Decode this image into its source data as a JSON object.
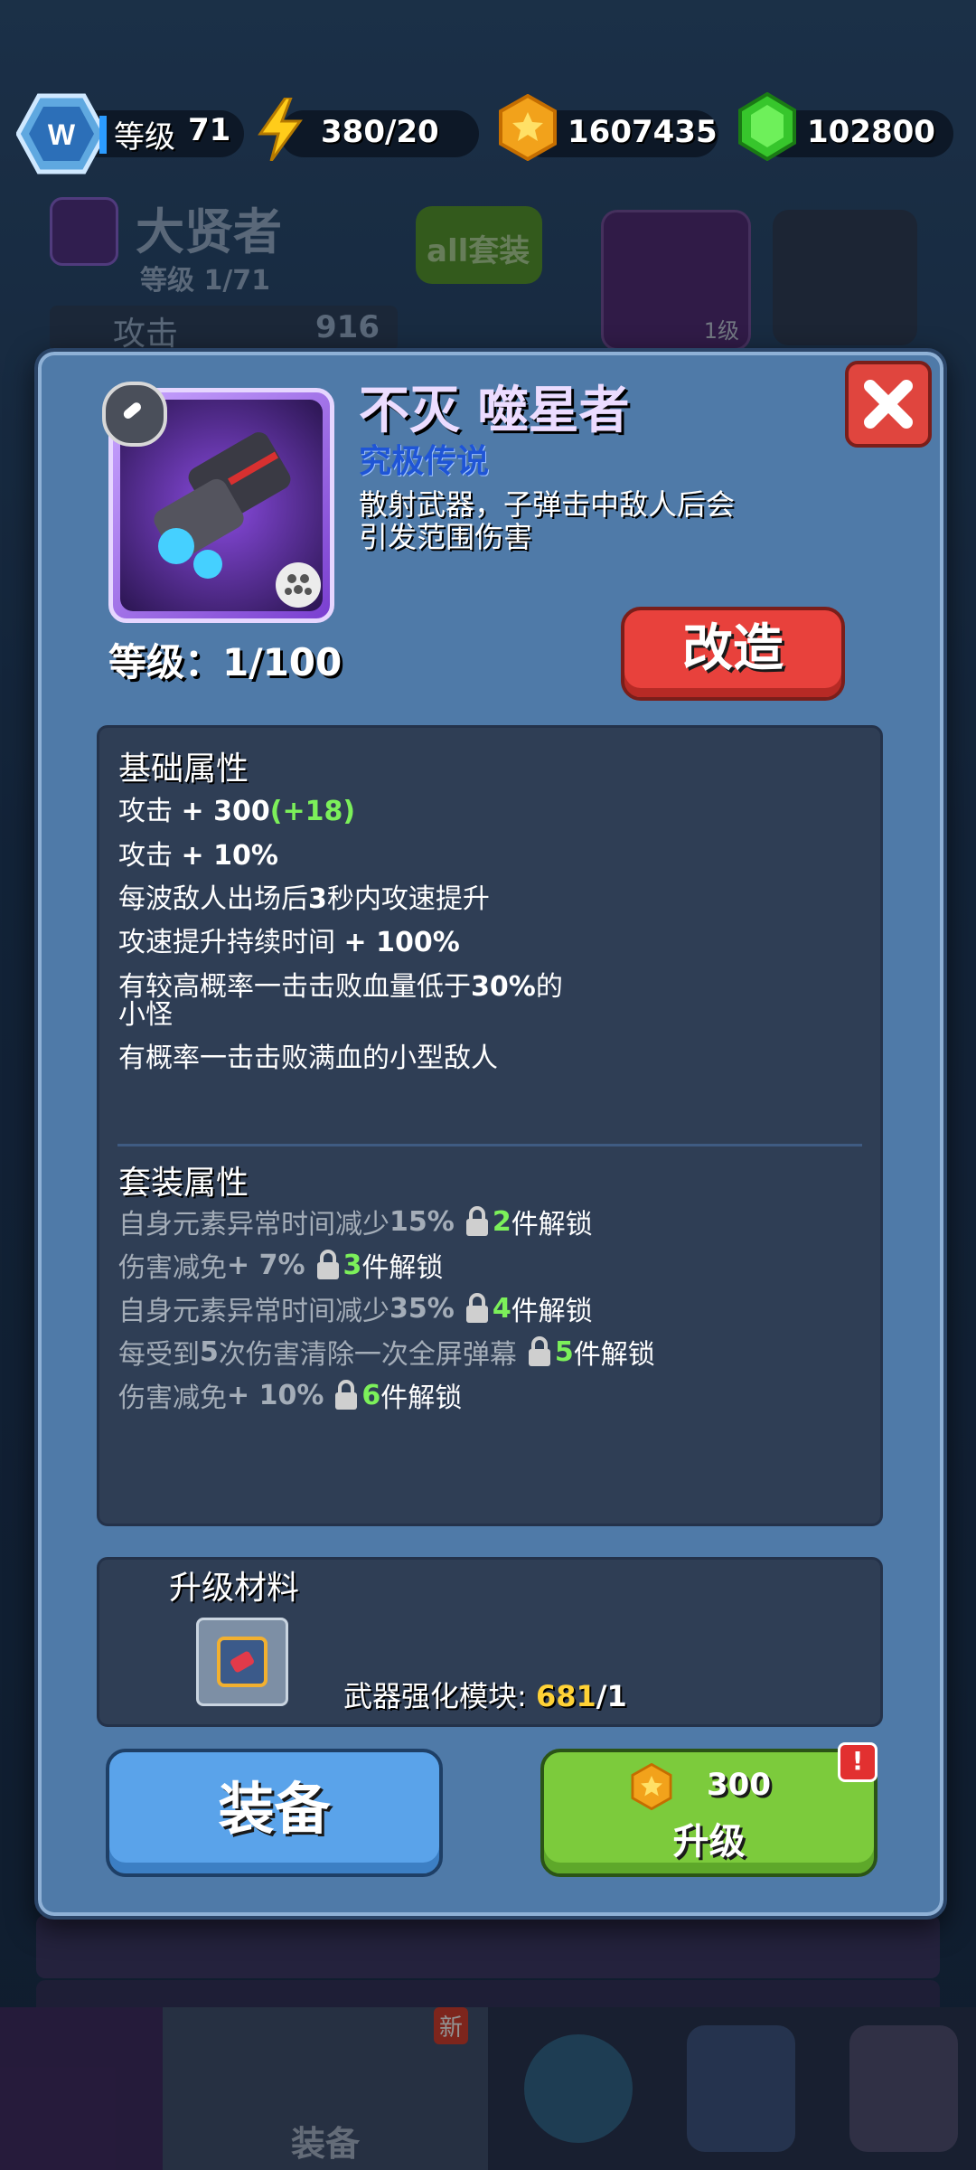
{
  "top_bar": {
    "level_label": "等级",
    "level_value": "71",
    "energy": "380/20",
    "coins": "1607435",
    "gems": "102800"
  },
  "background": {
    "hero_name": "大贤者",
    "hero_level": "等级 1/71",
    "all_sets_button": "all套装",
    "attack_label": "攻击",
    "attack_value": "916",
    "equipped_level": "1级",
    "slot_level": "1级",
    "nav_equipment": "装备",
    "nav_new_badge": "新"
  },
  "modal": {
    "item_name": "不灭 噬星者",
    "rarity": "究极传说",
    "description_line1": "散射武器，子弹击中敌人后会",
    "description_line2": "引发范围伤害",
    "level_text": "等级：1/100",
    "modify_button": "改造",
    "close_icon": "close-icon",
    "base_section": {
      "title": "基础属性",
      "lines": [
        {
          "text": "攻击 ",
          "value": "+ 300",
          "bonus": "(+18)"
        },
        {
          "text": "攻击 ",
          "value": "+ 10%"
        },
        {
          "text": "每波敌人出场后",
          "value": "3",
          "tail": "秒内攻速提升"
        },
        {
          "text": "攻速提升持续时间 ",
          "value": "+ 100%"
        },
        {
          "text": "有较高概率一击击败血量低于",
          "value": "30%",
          "tail": "的"
        },
        {
          "text": "小怪"
        },
        {
          "text": "有概率一击击败满血的小型敌人"
        }
      ]
    },
    "set_section": {
      "title": "套装属性",
      "lines": [
        {
          "text": "自身元素异常时间减少",
          "value": "15%",
          "count": "2",
          "unlock": " 件解锁"
        },
        {
          "text": "伤害减免 ",
          "value": "+ 7%",
          "count": "3",
          "unlock": " 件解锁"
        },
        {
          "text": "自身元素异常时间减少",
          "value": "35%",
          "count": "4",
          "unlock": " 件解锁"
        },
        {
          "text": "每受到",
          "value": "5",
          "text2": "次伤害清除一次全屏弹幕",
          "count": "5",
          "unlock": " 件解锁"
        },
        {
          "text": "伤害减免 ",
          "value": "+ 10%",
          "count": "6",
          "unlock": " 件解锁"
        }
      ]
    },
    "materials": {
      "title": "升级材料",
      "material_name": "武器强化模块:",
      "owned": "681",
      "required": "/1"
    },
    "equip_button": "装备",
    "upgrade_button": {
      "cost": "300",
      "label": "升级",
      "alert": "!"
    }
  },
  "colors": {
    "modal_bg": "#4f7aa8",
    "panel_bg": "#2f3e55",
    "red_button": "#e8413c",
    "blue_button": "#5aa3ea",
    "green_button": "#7ccb3c",
    "bonus_green": "#7cf05a",
    "rarity_blue": "#1f55d6",
    "amount_yellow": "#ffd236"
  }
}
